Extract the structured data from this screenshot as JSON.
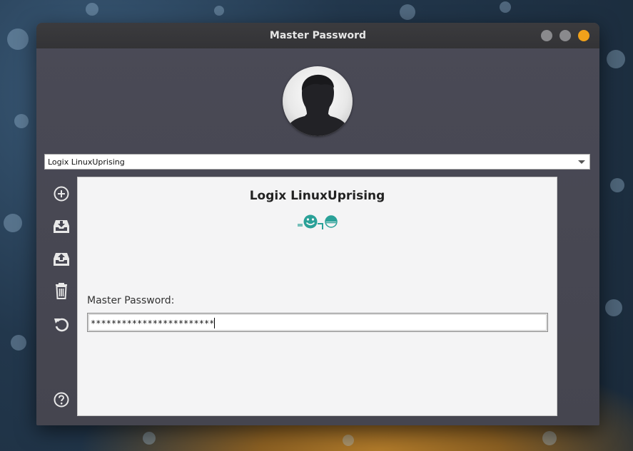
{
  "window": {
    "title": "Master Password",
    "controls": [
      "minimize",
      "maximize",
      "close"
    ]
  },
  "avatar": {
    "icon": "user-silhouette-icon"
  },
  "account_select": {
    "value": "Logix LinuxUprising"
  },
  "sidebar": {
    "buttons": [
      {
        "name": "add-user-button",
        "icon": "plus-circle-icon"
      },
      {
        "name": "import-button",
        "icon": "tray-download-icon"
      },
      {
        "name": "export-button",
        "icon": "tray-upload-icon"
      },
      {
        "name": "delete-button",
        "icon": "trash-icon"
      },
      {
        "name": "reset-button",
        "icon": "undo-arrow-icon"
      },
      {
        "name": "help-button",
        "icon": "question-circle-icon"
      }
    ]
  },
  "main": {
    "profile_name": "Logix LinuxUprising",
    "identicon_color": "#2aa198",
    "password_label": "Master Password:",
    "password_value": "************************"
  },
  "colors": {
    "window_bg": "#474752",
    "titlebar": "#38383b",
    "close_button": "#f0a11a",
    "panel_bg": "#f4f4f5"
  }
}
